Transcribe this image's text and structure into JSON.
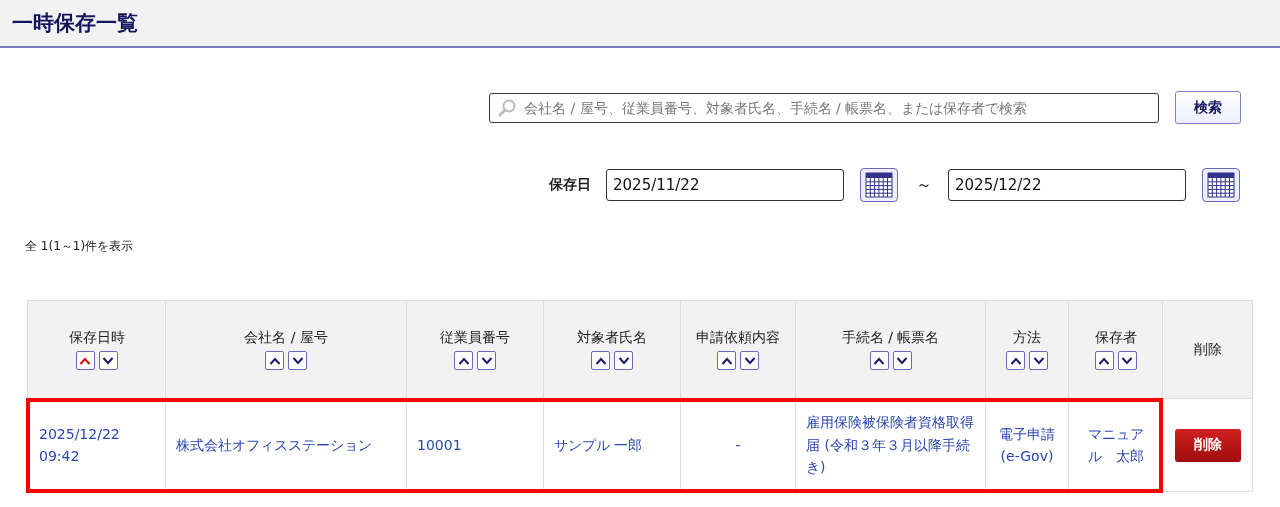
{
  "page_title": "一時保存一覧",
  "search": {
    "placeholder": "会社名 / 屋号、従業員番号、対象者氏名、手続名 / 帳票名、または保存者で検索",
    "button": "検索"
  },
  "date_filter": {
    "label": "保存日",
    "from": "2025/11/22",
    "separator": "～",
    "to": "2025/12/22"
  },
  "result_count": "全 1(1～1)件を表示",
  "table": {
    "columns": [
      {
        "label": "保存日時",
        "sort_up_selected": true
      },
      {
        "label": "会社名 / 屋号",
        "sort_up_selected": false
      },
      {
        "label": "従業員番号",
        "sort_up_selected": false
      },
      {
        "label": "対象者氏名",
        "sort_up_selected": false
      },
      {
        "label": "申請依頼内容",
        "sort_up_selected": false
      },
      {
        "label": "手続名 / 帳票名",
        "sort_up_selected": false
      },
      {
        "label": "方法",
        "sort_up_selected": false
      },
      {
        "label": "保存者",
        "sort_up_selected": false
      },
      {
        "label": "削除"
      }
    ],
    "rows": [
      {
        "highlighted": true,
        "cells": [
          "2025/12/22 09:42",
          "株式会社オフィスステーション",
          "10001",
          "サンプル 一郎",
          "-",
          "雇用保険被保険者資格取得届 (令和３年３月以降手続き)",
          "電子申請 (e-Gov)",
          "マニュアル　太郎"
        ],
        "delete_button": "削除"
      }
    ]
  }
}
